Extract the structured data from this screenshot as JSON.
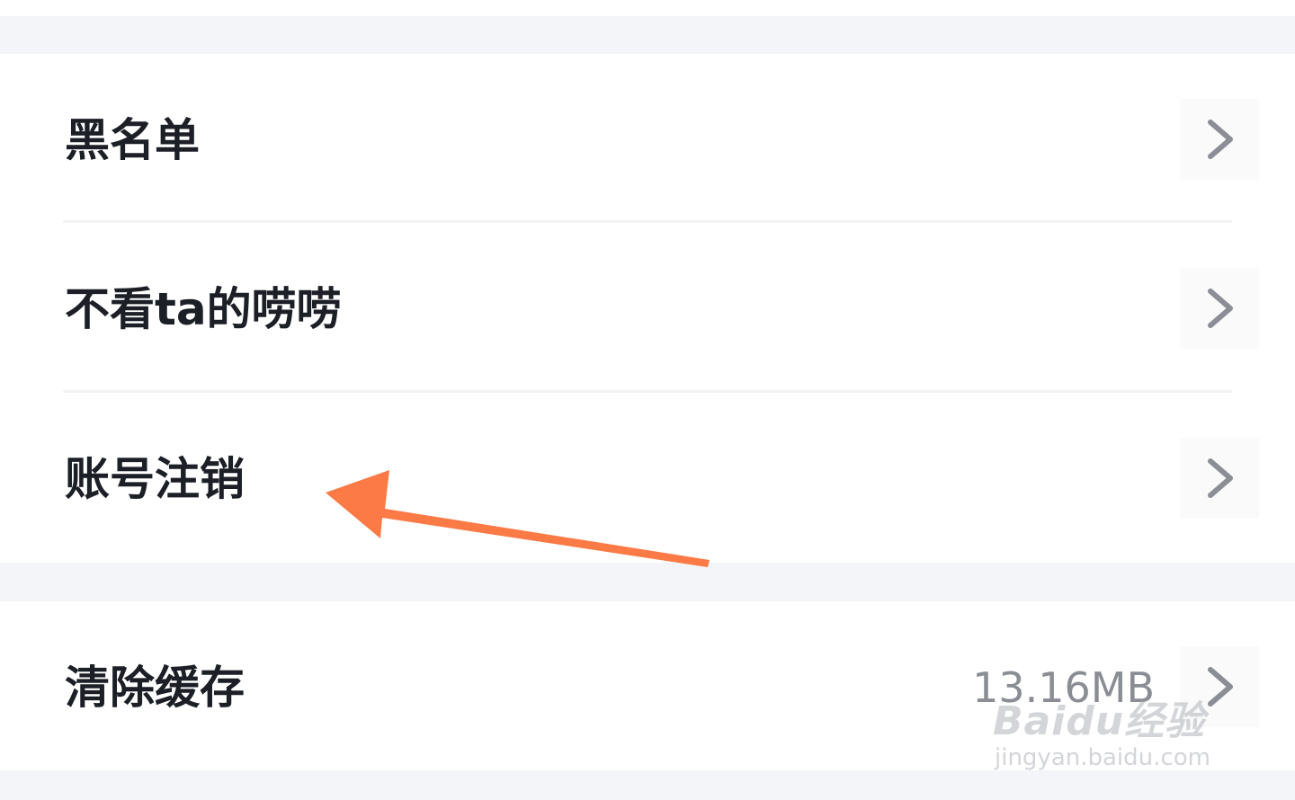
{
  "settings": {
    "items": [
      {
        "label": "黑名单"
      },
      {
        "label": "不看ta的唠唠"
      },
      {
        "label": "账号注销"
      }
    ],
    "cache": {
      "label": "清除缓存",
      "value": "13.16MB"
    }
  },
  "watermark": {
    "brand": "Baidu经验",
    "url": "jingyan.baidu.com"
  },
  "colors": {
    "background": "#f4f5f8",
    "card": "#ffffff",
    "text": "#1c1f26",
    "chevron": "#8b8e95",
    "annotation_arrow": "#fb7a45"
  },
  "icons": {
    "chevron": "chevron-right-icon",
    "annotation": "orange-arrow-pointer"
  }
}
